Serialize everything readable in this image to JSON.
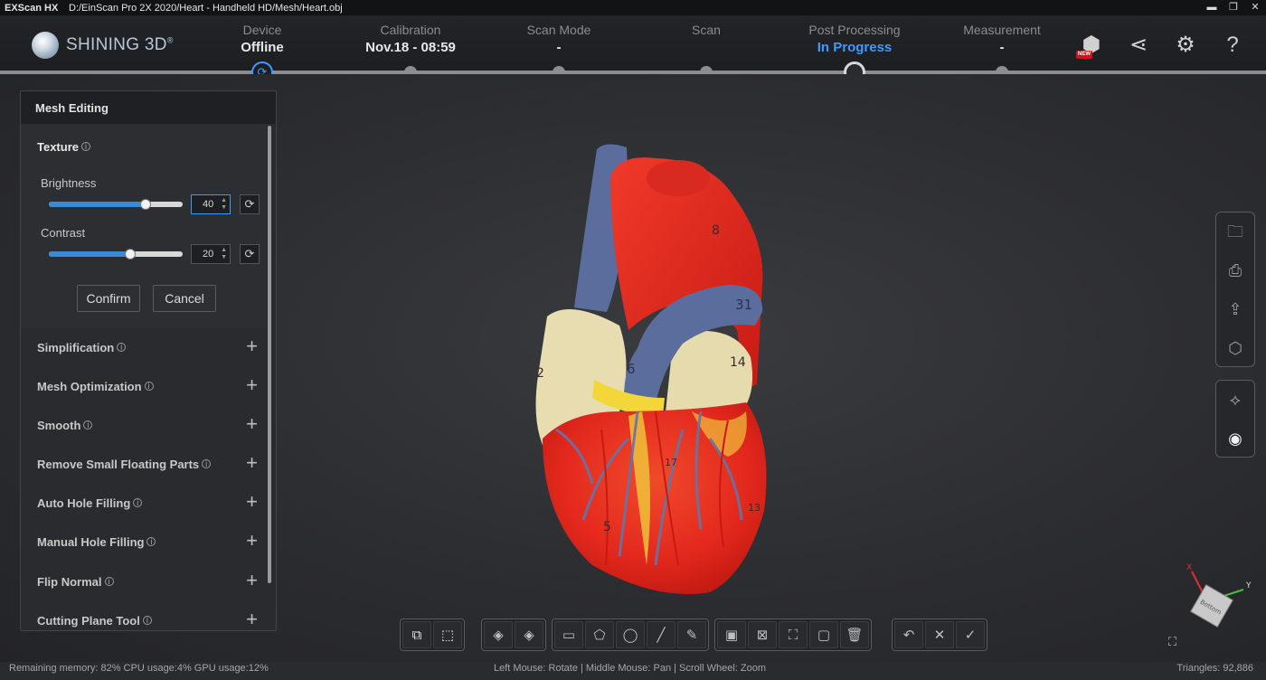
{
  "titlebar": {
    "app_name": "EXScan HX",
    "file_path": "D:/EinScan Pro 2X 2020/Heart - Handheld HD/Mesh/Heart.obj",
    "minimize": "▬",
    "maximize": "❐",
    "close": "✕"
  },
  "logo": {
    "text": "SHINING 3D",
    "mark": "®"
  },
  "steps": [
    {
      "name": "Device",
      "value": "Offline"
    },
    {
      "name": "Calibration",
      "value": "Nov.18 - 08:59"
    },
    {
      "name": "Scan Mode",
      "value": "-"
    },
    {
      "name": "Scan",
      "value": ""
    },
    {
      "name": "Post Processing",
      "value": "In Progress"
    },
    {
      "name": "Measurement",
      "value": "-"
    }
  ],
  "header_icons": {
    "new_badge": "NEW",
    "items": [
      "model-library-icon",
      "share-icon",
      "settings-icon",
      "help-icon"
    ]
  },
  "panel": {
    "title": "Mesh Editing",
    "texture": {
      "label": "Texture",
      "brightness_label": "Brightness",
      "brightness_value": "40",
      "brightness_fraction": 0.72,
      "contrast_label": "Contrast",
      "contrast_value": "20",
      "contrast_fraction": 0.61,
      "confirm": "Confirm",
      "cancel": "Cancel"
    },
    "sections": [
      "Simplification",
      "Mesh Optimization",
      "Smooth",
      "Remove Small Floating Parts",
      "Auto Hole Filling",
      "Manual Hole Filling",
      "Flip Normal",
      "Cutting Plane Tool"
    ]
  },
  "heart_labels": [
    "8",
    "31",
    "6",
    "2",
    "14",
    "5",
    "17",
    "13"
  ],
  "axis": {
    "x": "X",
    "y": "Y",
    "cube_face": "Bottom"
  },
  "status": {
    "left": "Remaining memory: 82% CPU usage:4%  GPU usage:12%",
    "middle": "Left Mouse: Rotate | Middle Mouse: Pan | Scroll Wheel: Zoom",
    "right": "Triangles: 92,886"
  },
  "colors": {
    "accent": "#3d9bff",
    "background": "#2a2b2f",
    "heart_red": "#e8261c",
    "vessel_blue": "#5b6d9c"
  }
}
